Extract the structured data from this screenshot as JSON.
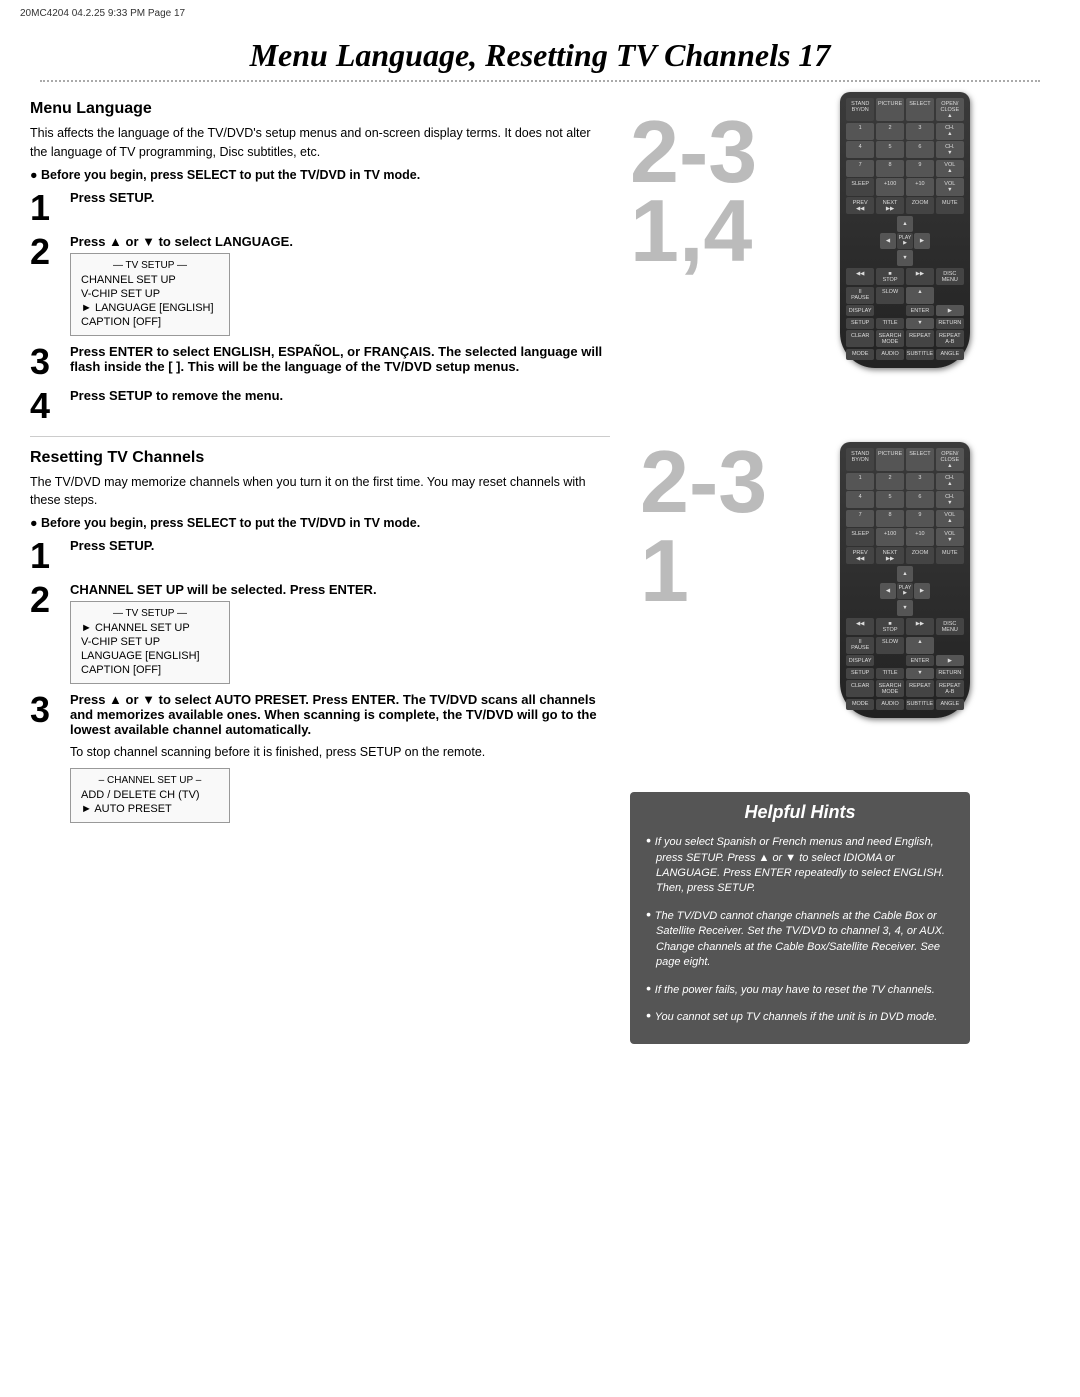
{
  "header": {
    "meta": "20MC4204  04.2.25  9:33 PM  Page 17"
  },
  "title": "Menu Language, Resetting TV Channels  17",
  "sections": {
    "menu_language": {
      "title": "Menu Language",
      "description": "This affects the language of the TV/DVD's setup menus and on-screen display terms. It does not alter the language of TV programming, Disc subtitles, etc.",
      "bullet": "Before you begin, press SELECT to put the TV/DVD in TV mode.",
      "steps": [
        {
          "num": "1",
          "text": "Press SETUP."
        },
        {
          "num": "2",
          "text": "Press ▲ or ▼ to select LANGUAGE.",
          "menu": {
            "title": "— TV SETUP —",
            "items": [
              "CHANNEL SET UP",
              "V-CHIP SET UP",
              "► LANGUAGE [ENGLISH]",
              "CAPTION    [OFF]"
            ]
          }
        },
        {
          "num": "3",
          "text": "Press ENTER to select ENGLISH, ESPAÑOL, or FRANÇAIS.",
          "subtext": "The selected language will flash inside the [ ]. This will be the language of the TV/DVD setup menus."
        },
        {
          "num": "4",
          "text": "Press SETUP to remove the menu."
        }
      ]
    },
    "resetting_tv": {
      "title": "Resetting TV Channels",
      "description": "The TV/DVD may memorize channels when you turn it on the first time. You may reset channels with these steps.",
      "bullet": "Before you begin, press SELECT to put the TV/DVD in TV mode.",
      "steps": [
        {
          "num": "1",
          "text": "Press SETUP."
        },
        {
          "num": "2",
          "text": "CHANNEL SET UP will be selected. Press ENTER.",
          "menu": {
            "title": "— TV SETUP —",
            "items": [
              "► CHANNEL SET UP",
              "V-CHIP SET UP",
              "LANGUAGE  [ENGLISH]",
              "CAPTION    [OFF]"
            ]
          }
        },
        {
          "num": "3",
          "text": "Press ▲ or ▼ to select AUTO PRESET. Press ENTER.",
          "subtext": "The TV/DVD scans all channels and memorizes available ones. When scanning is complete, the TV/DVD will go to the lowest available channel automatically.",
          "extra": "To stop channel scanning before it is finished, press SETUP on the remote.",
          "menu2": {
            "title": "– CHANNEL SET UP –",
            "items": [
              "ADD / DELETE CH (TV)",
              "► AUTO PRESET"
            ]
          }
        }
      ]
    }
  },
  "helpful_hints": {
    "title": "Helpful Hints",
    "hints": [
      "If you select Spanish or French menus and need English, press SETUP. Press ▲ or ▼ to select IDIOMA or LANGUAGE.  Press ENTER repeatedly to select ENGLISH. Then, press SETUP.",
      "The TV/DVD cannot change channels at the Cable Box or Satellite Receiver. Set the TV/DVD to channel 3, 4, or AUX. Change channels at the Cable Box/Satellite Receiver. See page eight.",
      "If the power fails, you may have to reset the TV channels.",
      "You cannot set up TV channels if the unit is in DVD mode."
    ]
  },
  "big_numbers_top": "2-3",
  "big_numbers_top2": "1,4",
  "big_numbers_bottom": "2-3",
  "big_numbers_bottom2": "1"
}
